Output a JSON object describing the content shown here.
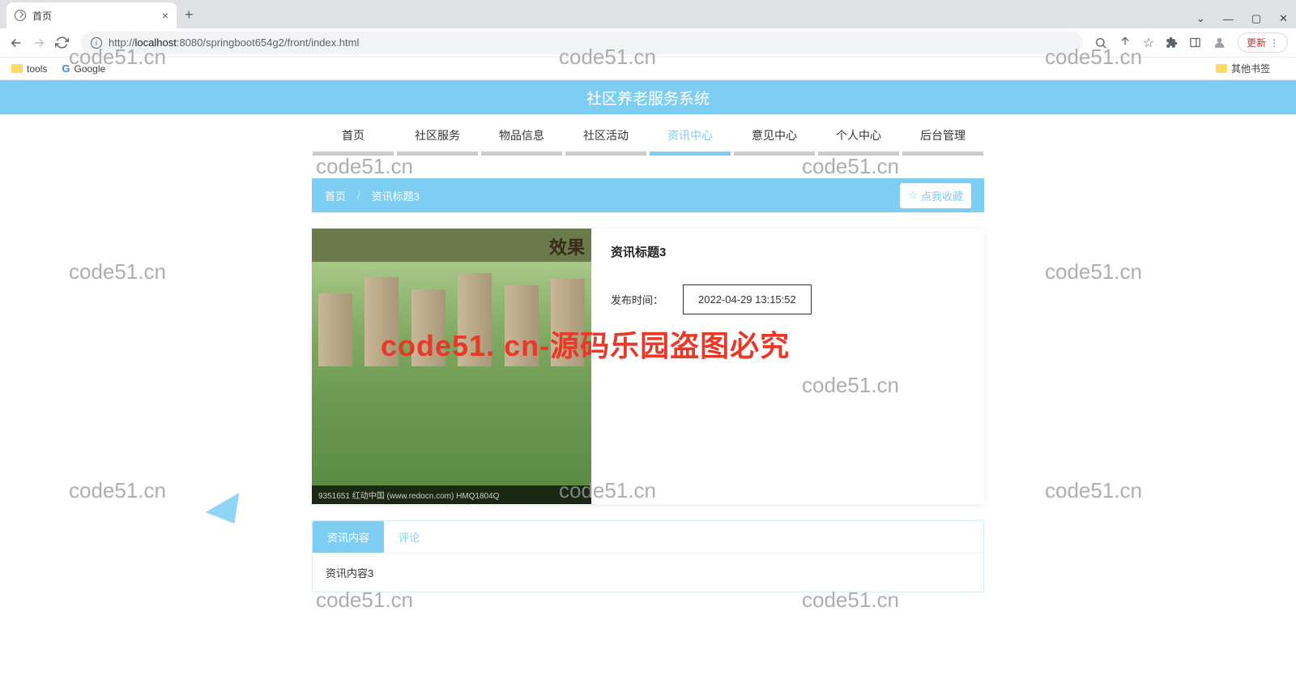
{
  "browser": {
    "tab_title": "首页",
    "url_prefix": "http://",
    "url_host": "localhost",
    "url_rest": ":8080/springboot654g2/front/index.html",
    "update_label": "更新"
  },
  "bookmarks": {
    "tools": "tools",
    "google": "Google",
    "other": "其他书签"
  },
  "site": {
    "title": "社区养老服务系统"
  },
  "nav": {
    "home": "首页",
    "service": "社区服务",
    "goods": "物品信息",
    "activity": "社区活动",
    "news": "资讯中心",
    "feedback": "意见中心",
    "personal": "个人中心",
    "admin": "后台管理"
  },
  "breadcrumb": {
    "home": "首页",
    "sep": "/",
    "current": "资讯标题3",
    "favorite": "点我收藏"
  },
  "article": {
    "title": "资讯标题3",
    "pub_label": "发布时间：",
    "pub_time": "2022-04-29 13:15:52",
    "img_footer": "9351651   红动中国 (www.redocn.com)   HMQ1804Q"
  },
  "tabs": {
    "content": "资讯内容",
    "comment": "评论",
    "body": "资讯内容3"
  },
  "watermarks": {
    "text": "code51.cn",
    "red": "code51. cn-源码乐园盗图必究"
  }
}
